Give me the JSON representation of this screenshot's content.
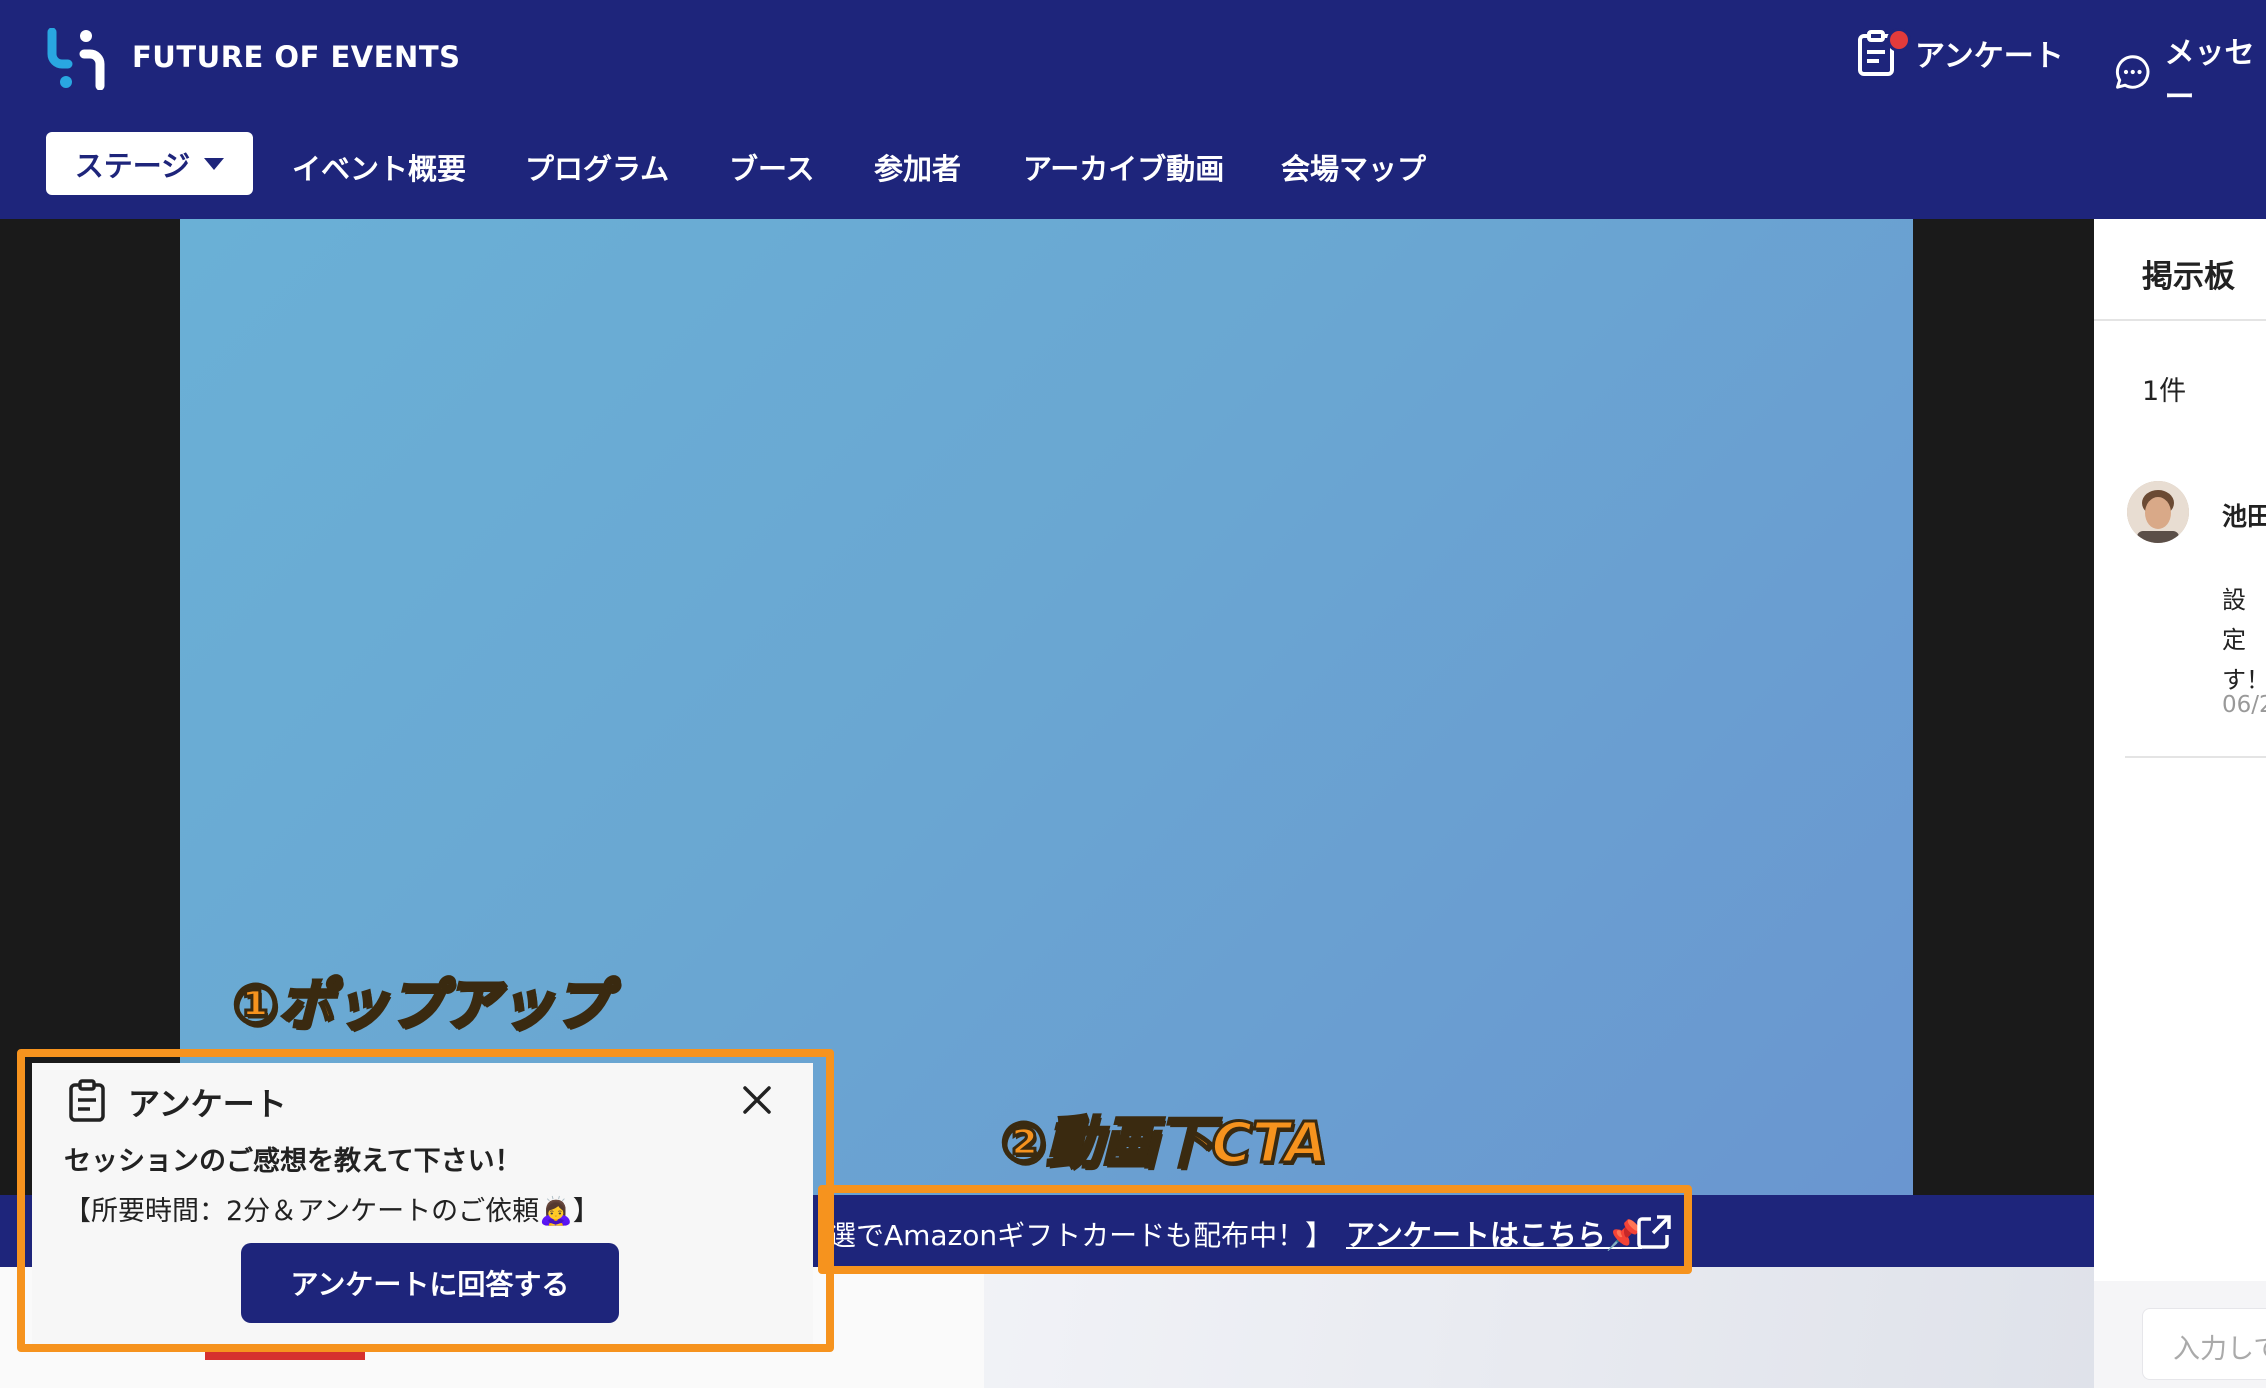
{
  "header": {
    "brand": "FUTURE OF EVENTS",
    "survey_label": "アンケート",
    "message_label": "メッセー",
    "colors": {
      "primary": "#1e257b",
      "notification": "#e23b3b",
      "accent_logo": "#29a7e1"
    }
  },
  "nav": {
    "stage_label": "ステージ",
    "items": [
      {
        "label": "イベント概要"
      },
      {
        "label": "プログラム"
      },
      {
        "label": "ブース"
      },
      {
        "label": "参加者"
      },
      {
        "label": "アーカイブ動画"
      },
      {
        "label": "会場マップ"
      }
    ]
  },
  "annotations": {
    "popup_label": "①ポップアップ",
    "cta_label": "②動画下CTA",
    "color": "#f6931e"
  },
  "popup": {
    "title": "アンケート",
    "heading": "セッションのご感想を教えて下さい！",
    "body": "【所要時間：2分＆アンケートのご依頼🙇‍♀️】",
    "button_label": "アンケートに回答する"
  },
  "cta": {
    "text": "選でAmazonギフトカードも配布中！】",
    "link_label": "アンケートはこちら📌"
  },
  "sidebar": {
    "title": "掲示板",
    "count": "1件",
    "post": {
      "author": "池田",
      "message_line1": "設定",
      "message_line2": "す！",
      "date": "06/2"
    },
    "input_placeholder": "入力して"
  }
}
